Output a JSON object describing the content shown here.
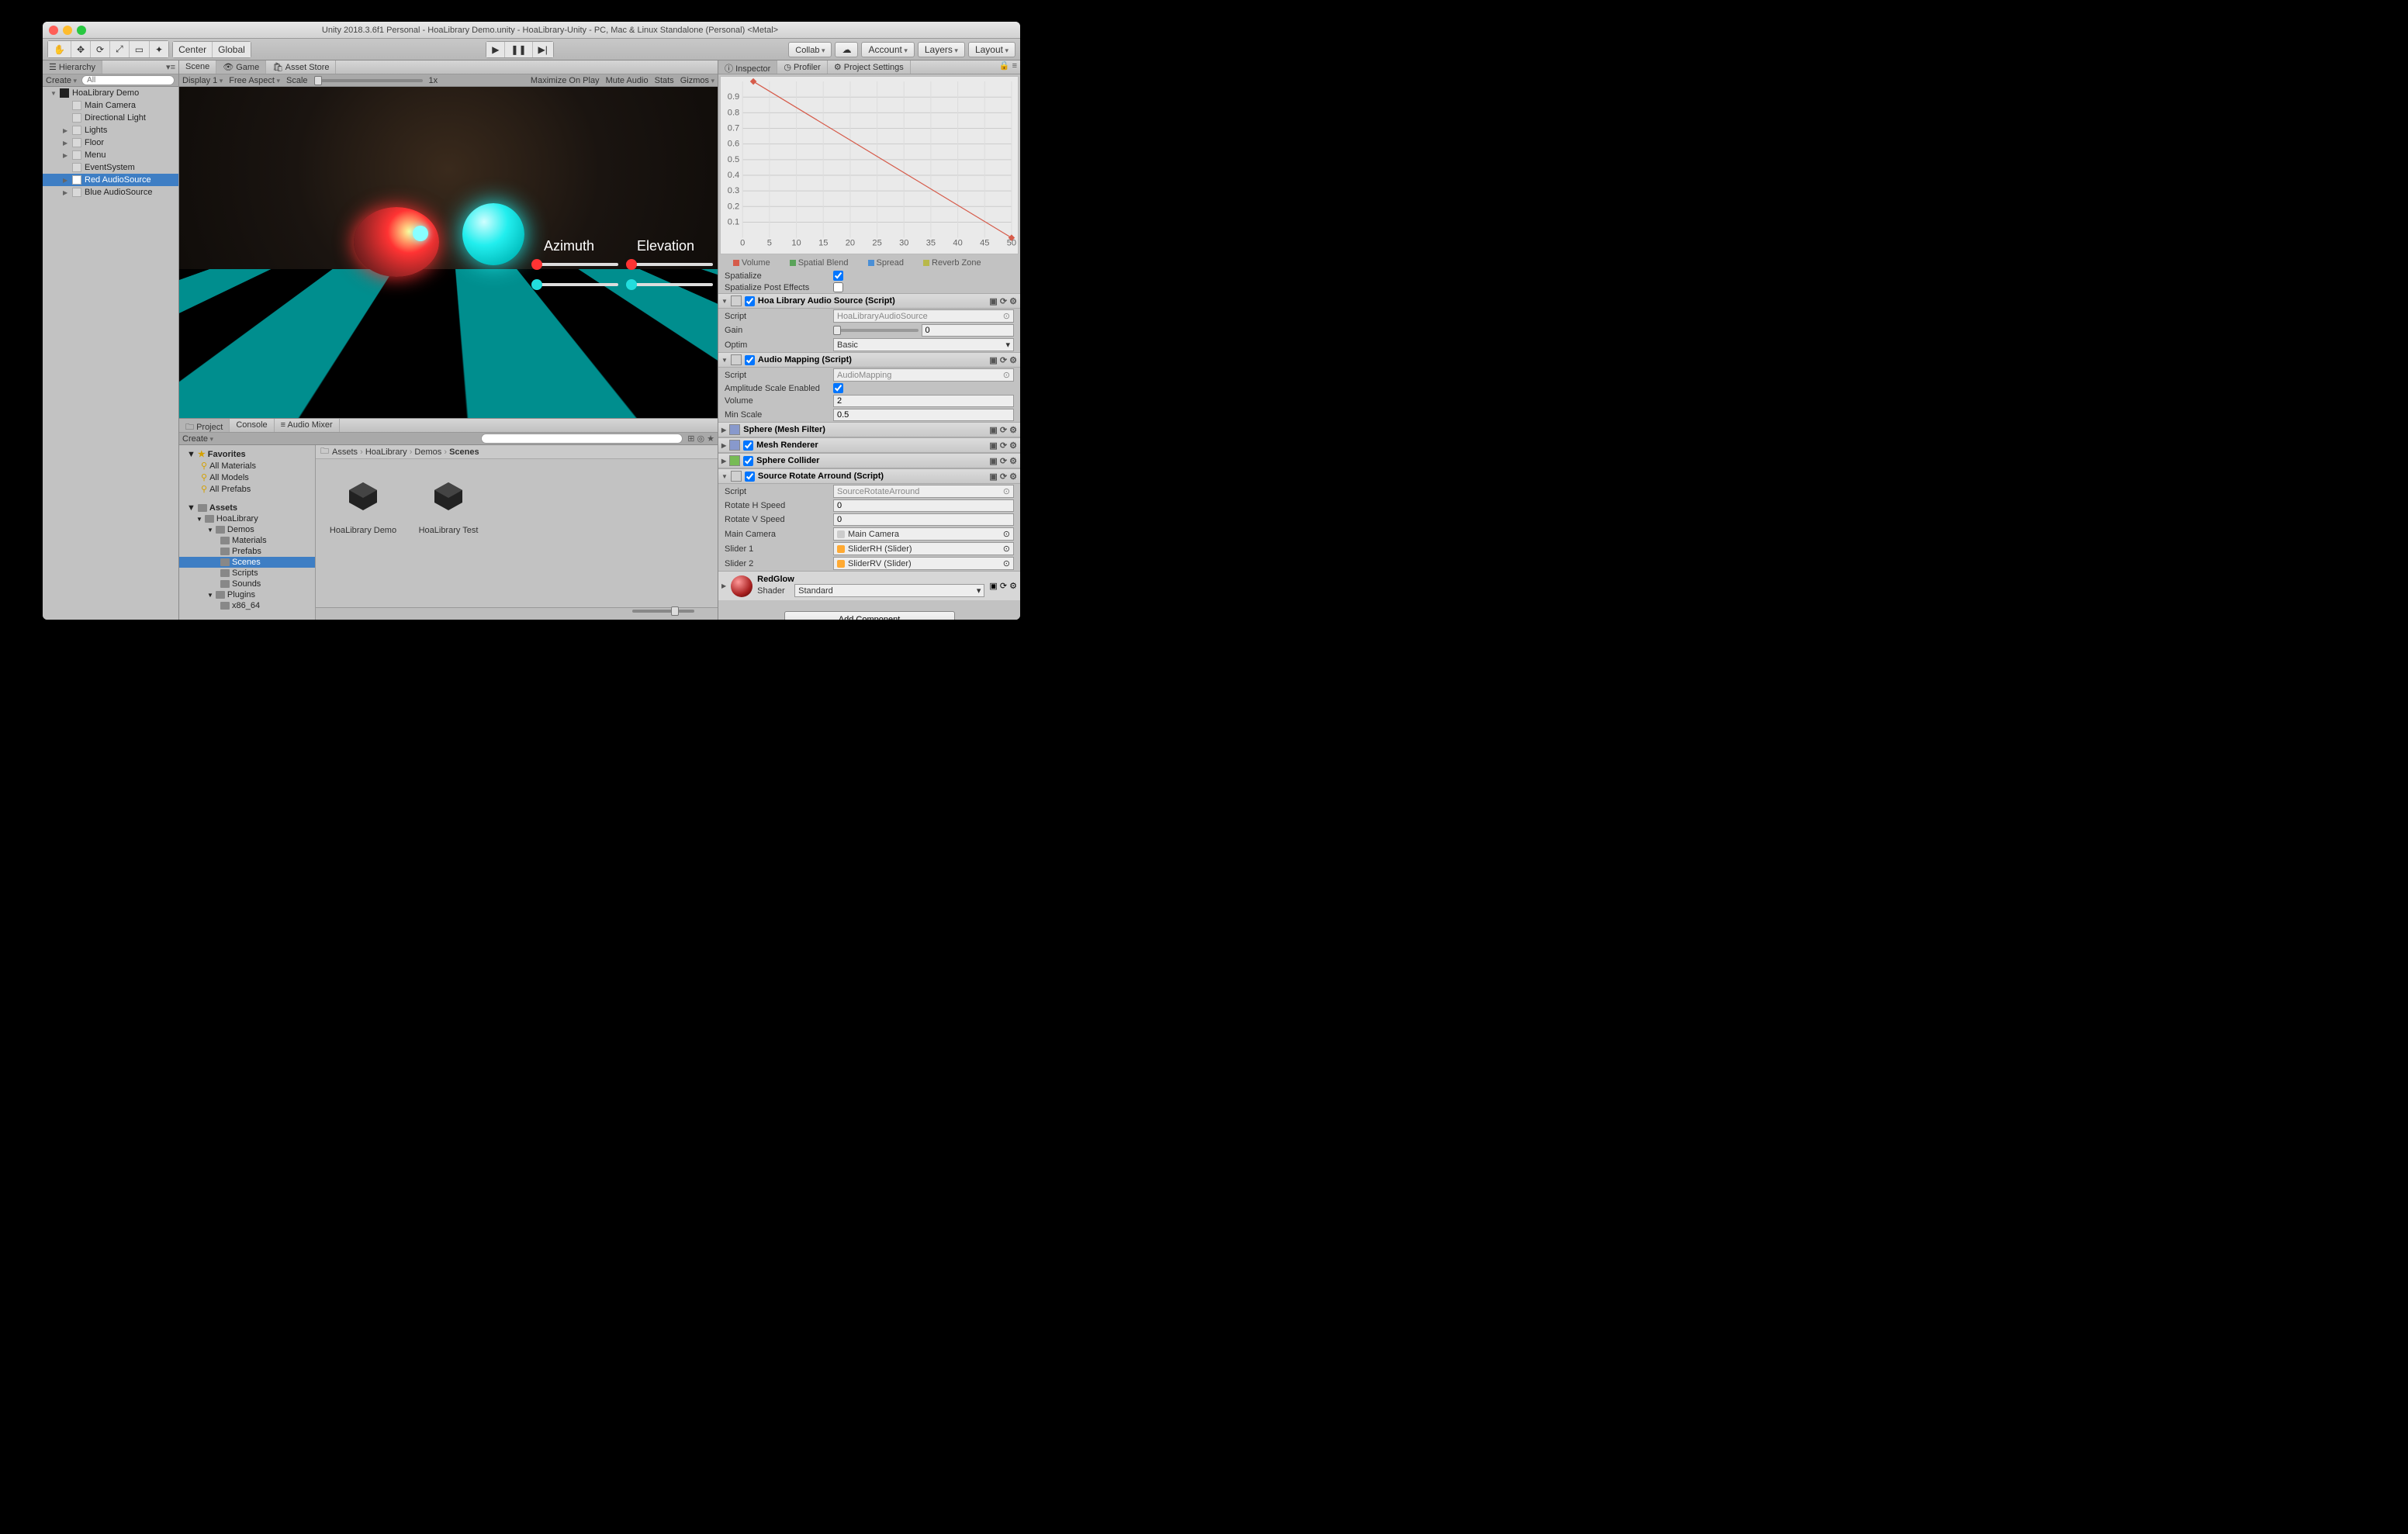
{
  "window_title": "Unity 2018.3.6f1 Personal - HoaLibrary Demo.unity - HoaLibrary-Unity - PC, Mac & Linux Standalone (Personal) <Metal>",
  "toolbar": {
    "center": "Center",
    "global": "Global",
    "collab": "Collab",
    "account": "Account",
    "layers": "Layers",
    "layout": "Layout"
  },
  "hierarchy": {
    "tab": "Hierarchy",
    "create": "Create",
    "search_ph": "All",
    "root": "HoaLibrary Demo",
    "items": [
      "Main Camera",
      "Directional Light",
      "Lights",
      "Floor",
      "Menu",
      "EventSystem",
      "Red AudioSource",
      "Blue AudioSource"
    ],
    "expandable": [
      2,
      3,
      4,
      6,
      7
    ],
    "selected": 6
  },
  "center_tabs": {
    "scene": "Scene",
    "game": "Game",
    "asset_store": "Asset Store",
    "active": "game"
  },
  "game_bar": {
    "display": "Display 1",
    "aspect": "Free Aspect",
    "scale_lbl": "Scale",
    "scale_val": "1x",
    "max": "Maximize On Play",
    "mute": "Mute Audio",
    "stats": "Stats",
    "gizmos": "Gizmos"
  },
  "viewport": {
    "azimuth": "Azimuth",
    "elevation": "Elevation"
  },
  "project_tabs": {
    "project": "Project",
    "console": "Console",
    "audio_mixer": "Audio Mixer"
  },
  "project": {
    "create": "Create",
    "favorites_hdr": "Favorites",
    "favorites": [
      "All Materials",
      "All Models",
      "All Prefabs"
    ],
    "assets_hdr": "Assets",
    "tree": [
      "HoaLibrary",
      "Demos",
      "Materials",
      "Prefabs",
      "Scenes",
      "Scripts",
      "Sounds",
      "Plugins",
      "x86_64"
    ],
    "tree_sel": 4,
    "breadcrumb": [
      "Assets",
      "HoaLibrary",
      "Demos",
      "Scenes"
    ],
    "assets": [
      "HoaLibrary Demo",
      "HoaLibrary Test"
    ]
  },
  "inspector_tabs": {
    "inspector": "Inspector",
    "profiler": "Profiler",
    "settings": "Project Settings"
  },
  "chart_data": {
    "type": "line",
    "x": [
      0,
      5,
      10,
      15,
      20,
      25,
      30,
      35,
      40,
      45,
      50
    ],
    "yticks": [
      0.1,
      0.2,
      0.3,
      0.4,
      0.5,
      0.6,
      0.7,
      0.8,
      0.9
    ],
    "series": [
      {
        "name": "Volume",
        "color": "#d65b4a",
        "points": [
          [
            2,
            1.0
          ],
          [
            50,
            0.0
          ]
        ]
      }
    ],
    "legend": [
      "Volume",
      "Spatial Blend",
      "Spread",
      "Reverb Zone"
    ],
    "legend_colors": [
      "#d65b4a",
      "#5aa35a",
      "#4a8fd6",
      "#b8b84a"
    ]
  },
  "inspector": {
    "spatialize": "Spatialize",
    "spatialize_val": true,
    "spat_post": "Spatialize Post Effects",
    "spat_post_val": false,
    "hoa_src": {
      "hdr": "Hoa Library Audio Source (Script)",
      "script": "Script",
      "script_val": "HoaLibraryAudioSource",
      "gain": "Gain",
      "gain_val": "0",
      "optim": "Optim",
      "optim_val": "Basic"
    },
    "audio_map": {
      "hdr": "Audio Mapping (Script)",
      "script": "Script",
      "script_val": "AudioMapping",
      "amp": "Amplitude Scale Enabled",
      "amp_val": true,
      "vol": "Volume",
      "vol_val": "2",
      "min": "Min Scale",
      "min_val": "0.5"
    },
    "sphere_mf": "Sphere (Mesh Filter)",
    "mesh_renderer": "Mesh Renderer",
    "sphere_collider": "Sphere Collider",
    "rotate": {
      "hdr": "Source Rotate Arround (Script)",
      "script": "Script",
      "script_val": "SourceRotateArround",
      "rh": "Rotate H Speed",
      "rh_val": "0",
      "rv": "Rotate V Speed",
      "rv_val": "0",
      "cam": "Main Camera",
      "cam_val": "Main Camera",
      "s1": "Slider 1",
      "s1_val": "SliderRH (Slider)",
      "s2": "Slider 2",
      "s2_val": "SliderRV (Slider)"
    },
    "material": {
      "name": "RedGlow",
      "shader_lbl": "Shader",
      "shader": "Standard"
    },
    "add": "Add Component"
  }
}
